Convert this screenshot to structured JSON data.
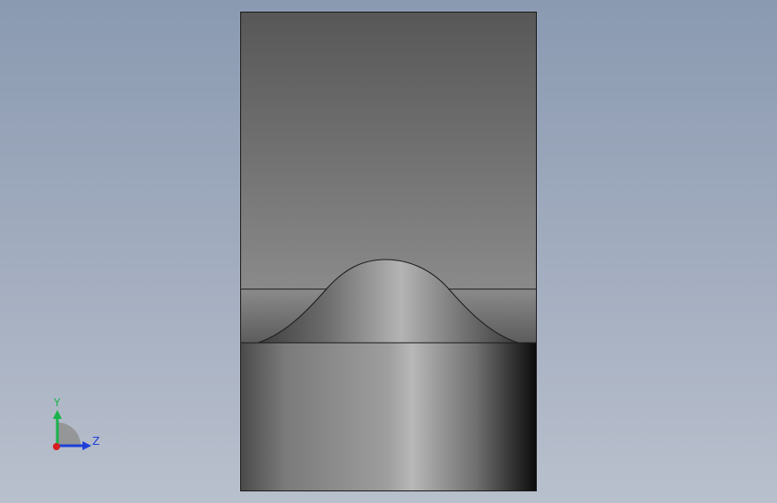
{
  "viewport": {
    "background_top": "#8a9ab1",
    "background_bottom": "#b9c0cd"
  },
  "model": {
    "type": "3d-part-view",
    "edge_color": "#1a1a1a"
  },
  "triad": {
    "y_label": "Y",
    "z_label": "Z",
    "y_color": "#19b24b",
    "z_color": "#1f3fd8",
    "x_color": "#d81e1e"
  }
}
